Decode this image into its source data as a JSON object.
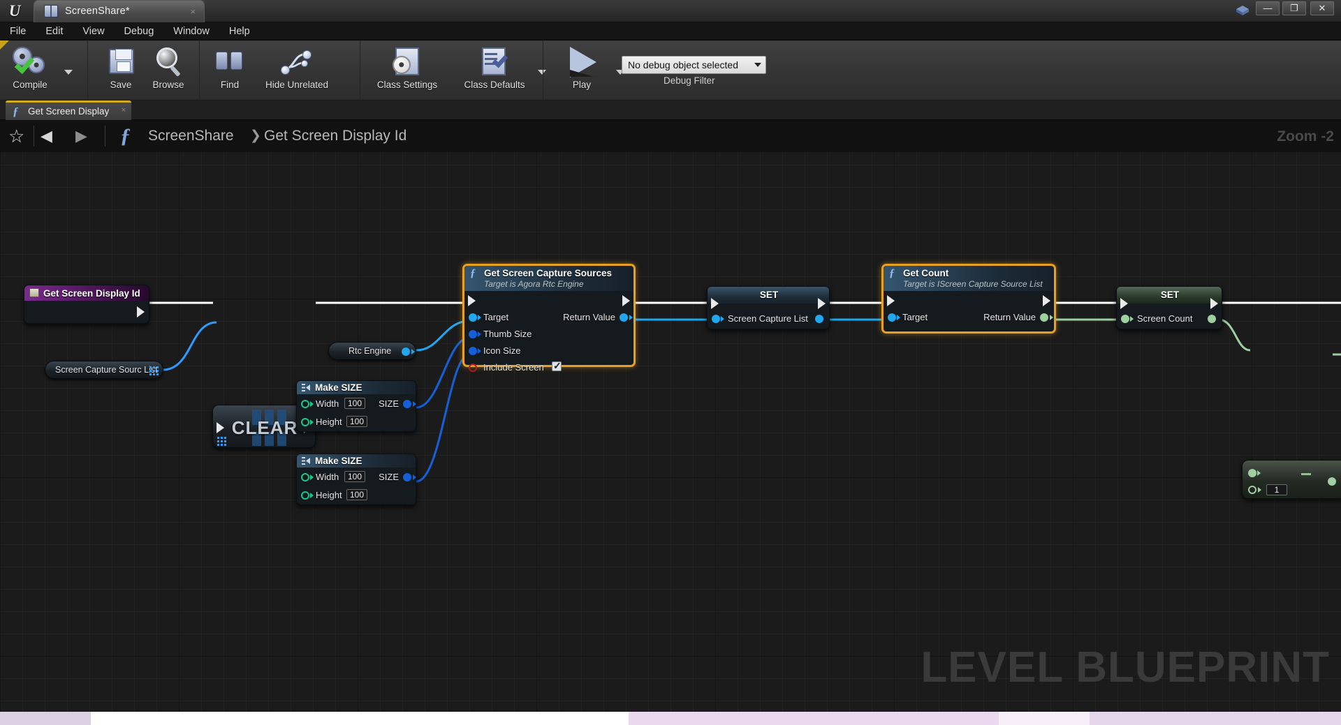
{
  "window": {
    "app_icon": "unreal-logo-icon",
    "tab_title": "ScreenShare*",
    "tab_close": "×",
    "minimize": "—",
    "maximize": "❐",
    "close": "✕"
  },
  "menubar": {
    "items": [
      "File",
      "Edit",
      "View",
      "Debug",
      "Window",
      "Help"
    ]
  },
  "toolbar": {
    "compile": "Compile",
    "save": "Save",
    "browse": "Browse",
    "find": "Find",
    "hide_unrelated": "Hide Unrelated",
    "class_settings": "Class Settings",
    "class_defaults": "Class Defaults",
    "play": "Play",
    "debug_object": "No debug object selected",
    "debug_filter_label": "Debug Filter"
  },
  "graph_tab": {
    "label": "Get Screen Display",
    "close": "×",
    "fx": "ƒ"
  },
  "breadcrumb": {
    "star": "☆",
    "back": "◀",
    "forward": "▶",
    "fx": "ƒ",
    "root": "ScreenShare",
    "separator": "❯",
    "leaf": "Get Screen Display Id"
  },
  "canvas": {
    "zoom_label": "Zoom -2",
    "watermark": "LEVEL BLUEPRINT"
  },
  "nodes": {
    "get_screen_display_id": {
      "title": "Get Screen Display Id",
      "kind": "event-entry"
    },
    "screen_capture_sourc_list_get": {
      "label": "Screen Capture Sourc List"
    },
    "clear": {
      "title": "CLEAR"
    },
    "rtc_engine_get": {
      "label": "Rtc Engine"
    },
    "make_size_1": {
      "title": "Make SIZE",
      "width_label": "Width",
      "width_value": "100",
      "height_label": "Height",
      "height_value": "100",
      "out_label": "SIZE"
    },
    "make_size_2": {
      "title": "Make SIZE",
      "width_label": "Width",
      "width_value": "100",
      "height_label": "Height",
      "height_value": "100",
      "out_label": "SIZE"
    },
    "get_screen_capture_sources": {
      "title": "Get Screen Capture Sources",
      "subtitle": "Target is Agora Rtc Engine",
      "inputs": [
        "Target",
        "Thumb Size",
        "Icon Size",
        "Include Screen"
      ],
      "include_screen_checked": true,
      "output": "Return Value",
      "selected": true
    },
    "set_screen_capture_list": {
      "title": "SET",
      "pin": "Screen Capture List"
    },
    "get_count": {
      "title": "Get Count",
      "subtitle": "Target is IScreen Capture Source List",
      "input": "Target",
      "output": "Return Value",
      "selected": true
    },
    "set_screen_count": {
      "title": "SET",
      "pin": "Screen Count"
    },
    "subtract": {
      "operator": "-",
      "operand_value": "1"
    }
  },
  "colors": {
    "accent_selection": "#e8a022",
    "exec_wire": "#ffffff",
    "object_wire": "#1fa8f0",
    "int_wire": "#9ecfa1",
    "struct_wire": "#1560d8",
    "tab_underline": "#d3aa23"
  }
}
